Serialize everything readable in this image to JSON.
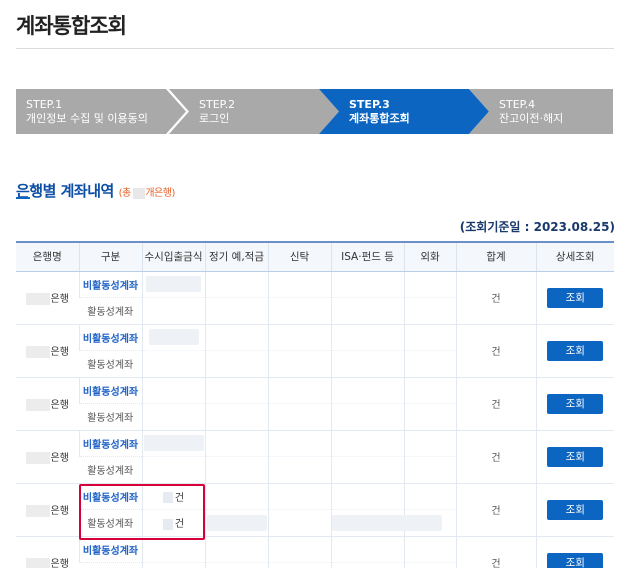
{
  "page": {
    "title": "계좌통합조회"
  },
  "steps": [
    {
      "num": "STEP.1",
      "label": "개인정보 수집 및 이용동의",
      "active": false
    },
    {
      "num": "STEP.2",
      "label": "로그인",
      "active": false
    },
    {
      "num": "STEP.3",
      "label": "계좌통합조회",
      "active": true
    },
    {
      "num": "STEP.4",
      "label": "잔고이전·해지",
      "active": false
    }
  ],
  "section": {
    "title": "은행별 계좌내역",
    "sub_prefix": "(총",
    "sub_suffix": "개은행)"
  },
  "ref_date": "(조회기준일 : 2023.08.25)",
  "table": {
    "headers": [
      "은행명",
      "구분",
      "수시입출금식",
      "정기 예,적금",
      "신탁",
      "ISA·펀드 등",
      "외화",
      "합계",
      "상세조회"
    ],
    "bank_suffix": "은행",
    "type_inactive": "비활동성계좌",
    "type_active": "활동성계좌",
    "count_unit": "건",
    "view_label": "조회",
    "rows": 6
  },
  "colors": {
    "accent": "#0d65c2",
    "highlight": "#d8003a",
    "step_inactive": "#a9a9a9"
  }
}
